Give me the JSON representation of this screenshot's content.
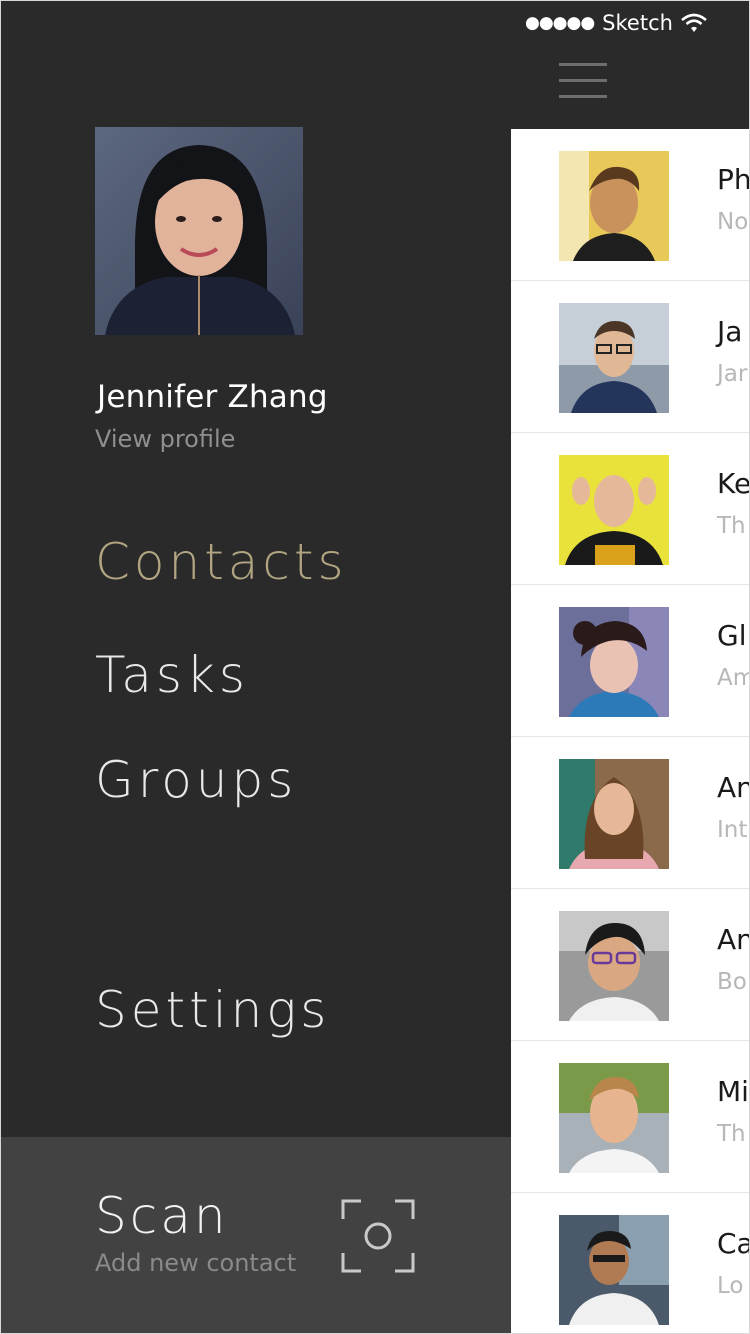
{
  "drawer": {
    "user": {
      "name": "Jennifer Zhang",
      "subtitle": "View profile"
    },
    "menu": [
      {
        "label": "Contacts",
        "active": true
      },
      {
        "label": "Tasks",
        "active": false
      },
      {
        "label": "Groups",
        "active": false
      }
    ],
    "settings_label": "Settings",
    "scan": {
      "title": "Scan",
      "subtitle": "Add new contact",
      "icon": "scan-camera-icon"
    },
    "colors": {
      "background": "#2a2a2a",
      "scan_background": "#424242",
      "active": "#b2a582"
    }
  },
  "status_bar": {
    "signal": "●●●●●",
    "carrier": "Sketch",
    "icon": "wifi-icon"
  },
  "header": {
    "menu_icon": "hamburger-icon"
  },
  "contacts": [
    {
      "name": "Ph",
      "subtitle": "No"
    },
    {
      "name": "Ja",
      "subtitle": "Jar"
    },
    {
      "name": "Ke",
      "subtitle": "Th"
    },
    {
      "name": "Gl",
      "subtitle": "Am"
    },
    {
      "name": "An",
      "subtitle": "Int"
    },
    {
      "name": "An",
      "subtitle": "Bo"
    },
    {
      "name": "Mi",
      "subtitle": "Th"
    },
    {
      "name": "Ca",
      "subtitle": "Lo"
    }
  ]
}
